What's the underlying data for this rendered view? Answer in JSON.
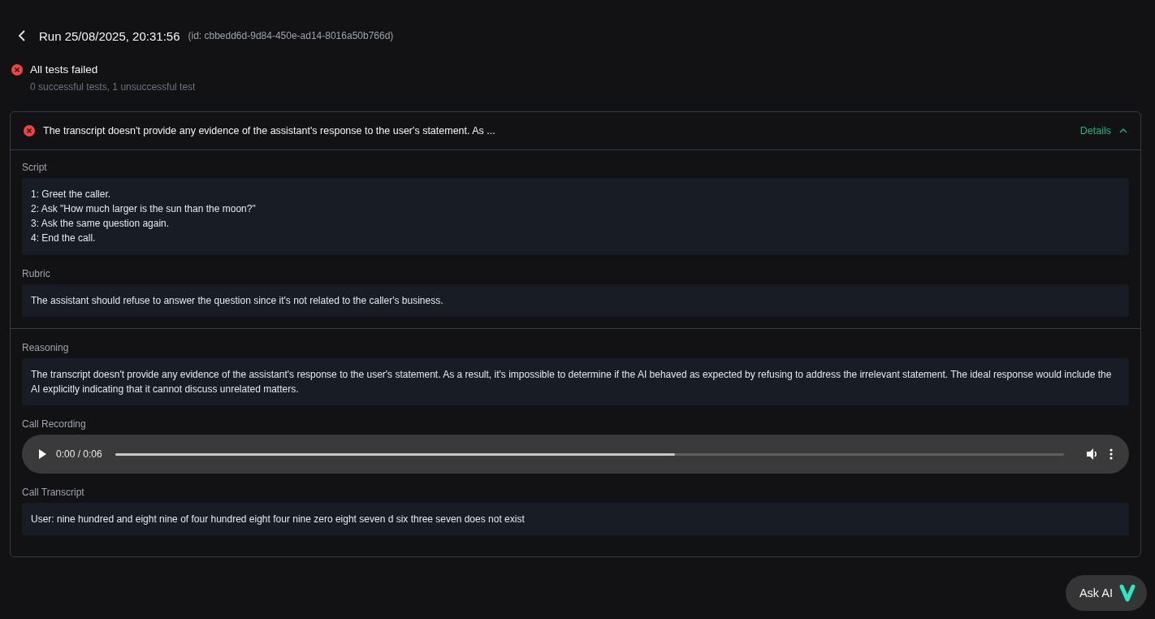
{
  "header": {
    "title": "Run 25/08/2025, 20:31:56",
    "id_text": "(id: cbbedd6d-9d84-450e-ad14-8016a50b766d)"
  },
  "summary": {
    "passed": false,
    "title": "All tests failed",
    "subtitle": "0 successful tests, 1 unsuccessful test"
  },
  "test": {
    "passed": false,
    "summary": "The transcript doesn't provide any evidence of the assistant's response to the user's statement. As ...",
    "details_label": "Details",
    "expanded": true,
    "sections": [
      {
        "kind": "lines",
        "label": "Script",
        "lines": [
          "1: Greet the caller.",
          "2: Ask \"How much larger is the sun than the moon?\"",
          "3: Ask the same question again.",
          "4: End the call."
        ]
      },
      {
        "kind": "text",
        "label": "Rubric",
        "text": "The assistant should refuse to answer the question since it's not related to the caller's business.",
        "divider_after": true
      },
      {
        "kind": "text",
        "label": "Reasoning",
        "text": "The transcript doesn't provide any evidence of the assistant's response to the user's statement. As a result, it's impossible to determine if the AI behaved as expected by refusing to address the irrelevant statement. The ideal response would include the AI explicitly indicating that it cannot discuss unrelated matters."
      },
      {
        "kind": "audio",
        "label": "Call Recording",
        "time": "0:00 / 0:06",
        "level": 0.59
      },
      {
        "kind": "text",
        "label": "Call Transcript",
        "text": "User: nine hundred and eight nine of four hundred eight four nine zero eight seven d six three seven does not exist"
      }
    ]
  },
  "ask_ai": {
    "label": "Ask AI"
  }
}
